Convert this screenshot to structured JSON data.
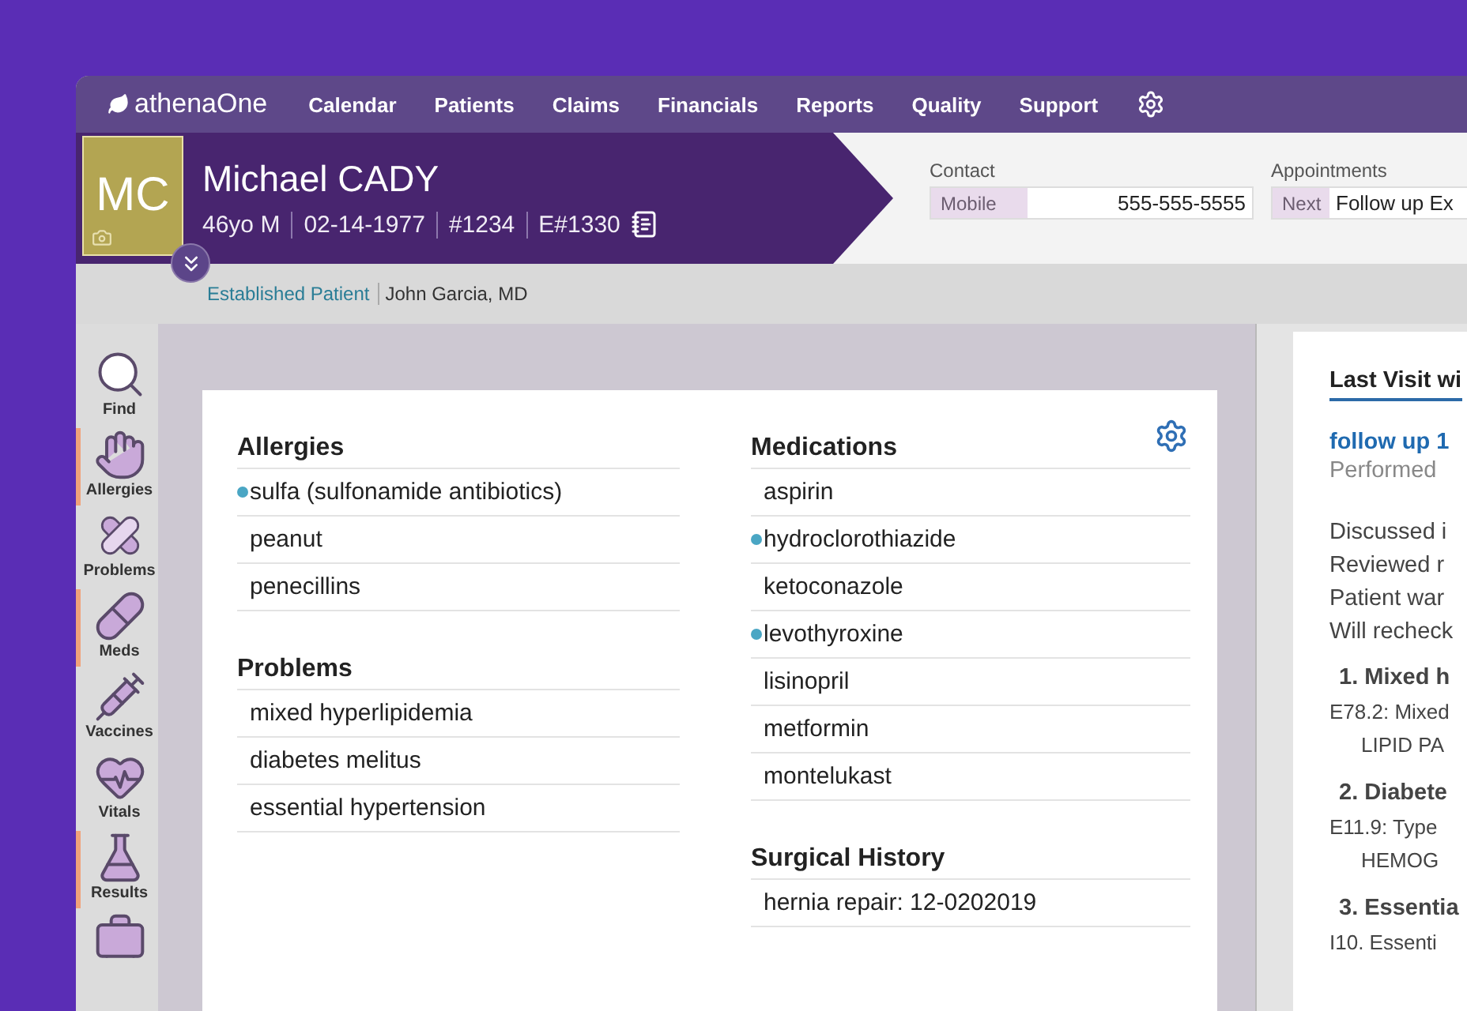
{
  "nav": {
    "brand": "athenaOne",
    "items": [
      "Calendar",
      "Patients",
      "Claims",
      "Financials",
      "Reports",
      "Quality",
      "Support"
    ]
  },
  "patient": {
    "initials": "MC",
    "name": "Michael CADY",
    "details": [
      "46yo M",
      "02-14-1977",
      "#1234",
      "E#1330"
    ],
    "status": "Established Patient",
    "provider": "John Garcia, MD"
  },
  "contact": {
    "title": "Contact",
    "label": "Mobile",
    "value": "555-555-5555"
  },
  "appointments": {
    "title": "Appointments",
    "label": "Next",
    "value": "Follow up Ex"
  },
  "sidebar": [
    {
      "kind": "find",
      "label": "Find",
      "flagged": false
    },
    {
      "kind": "allergies",
      "label": "Allergies",
      "flagged": true
    },
    {
      "kind": "problems",
      "label": "Problems",
      "flagged": false
    },
    {
      "kind": "meds",
      "label": "Meds",
      "flagged": true
    },
    {
      "kind": "vaccines",
      "label": "Vaccines",
      "flagged": false
    },
    {
      "kind": "vitals",
      "label": "Vitals",
      "flagged": false
    },
    {
      "kind": "results",
      "label": "Results",
      "flagged": true
    },
    {
      "kind": "kit",
      "flagged": false
    }
  ],
  "left_sections": [
    {
      "title": "Allergies",
      "items": [
        {
          "text": "sulfa (sulfonamide antibiotics)",
          "marked": true
        },
        {
          "text": "peanut",
          "marked": false
        },
        {
          "text": "penecillins",
          "marked": false
        }
      ]
    },
    {
      "title": "Problems",
      "items": [
        {
          "text": "mixed hyperlipidemia",
          "marked": false
        },
        {
          "text": "diabetes melitus",
          "marked": false
        },
        {
          "text": "essential hypertension",
          "marked": false
        }
      ]
    }
  ],
  "right_sections": [
    {
      "title": "Medications",
      "items": [
        {
          "text": "aspirin",
          "marked": false
        },
        {
          "text": "hydroclorothiazide",
          "marked": true
        },
        {
          "text": "ketoconazole",
          "marked": false
        },
        {
          "text": "levothyroxine",
          "marked": true
        },
        {
          "text": "lisinopril",
          "marked": false
        },
        {
          "text": "metformin",
          "marked": false
        },
        {
          "text": "montelukast",
          "marked": false
        }
      ]
    },
    {
      "title": "Surgical History",
      "items": [
        {
          "text": "hernia repair: 12-0202019",
          "marked": false
        }
      ]
    }
  ],
  "last_visit": {
    "tab": "Last Visit wi",
    "link": "follow up 1",
    "performed": "Performed",
    "notes": [
      "Discussed i",
      "Reviewed r",
      "Patient war",
      "Will recheck"
    ],
    "assessments": [
      {
        "title": "1. Mixed h",
        "code": "E78.2: Mixed",
        "order": "LIPID PA"
      },
      {
        "title": "2. Diabete",
        "code": "E11.9: Type",
        "order": "HEMOG"
      },
      {
        "title": "3. Essentia",
        "code": "I10. Essenti"
      }
    ]
  }
}
